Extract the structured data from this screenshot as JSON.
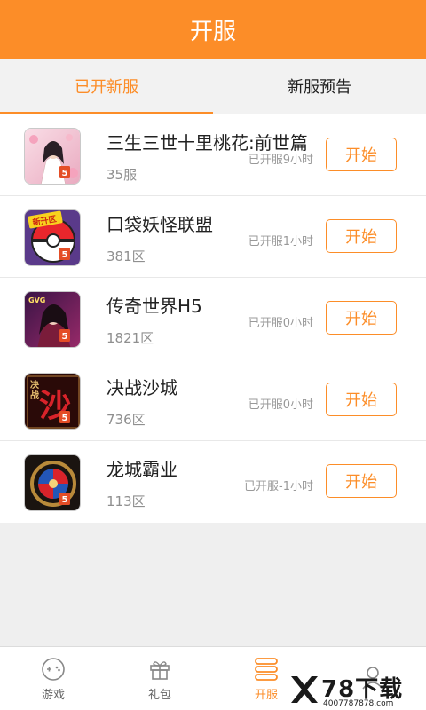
{
  "header": {
    "title": "开服"
  },
  "tabs": [
    {
      "label": "已开新服",
      "active": true
    },
    {
      "label": "新服预告",
      "active": false
    }
  ],
  "games": [
    {
      "title": "三生三世十里桃花:前世篇",
      "server": "35服",
      "status": "已开服9小时",
      "button": "开始",
      "icon": "peach-blossom-game-icon"
    },
    {
      "title": "口袋妖怪联盟",
      "server": "381区",
      "status": "已开服1小时",
      "button": "开始",
      "icon": "pokeball-game-icon"
    },
    {
      "title": "传奇世界H5",
      "server": "1821区",
      "status": "已开服0小时",
      "button": "开始",
      "icon": "legend-world-game-icon"
    },
    {
      "title": "决战沙城",
      "server": "736区",
      "status": "已开服0小时",
      "button": "开始",
      "icon": "sand-city-game-icon"
    },
    {
      "title": "龙城霸业",
      "server": "113区",
      "status": "已开服-1小时",
      "button": "开始",
      "icon": "dragon-city-game-icon"
    }
  ],
  "icon_badge": "5",
  "icon_texts": {
    "pokeball": "新开区",
    "legend": "GVG",
    "sand_a": "决",
    "sand_b": "战",
    "sand_c": "沙"
  },
  "bottom_nav": [
    {
      "label": "游戏",
      "icon": "gamepad-icon",
      "active": false
    },
    {
      "label": "礼包",
      "icon": "gift-icon",
      "active": false
    },
    {
      "label": "开服",
      "icon": "server-list-icon",
      "active": true
    },
    {
      "label": "",
      "icon": "user-icon",
      "active": false
    }
  ],
  "watermark": {
    "brand": "78下载",
    "url": "4007787878.com"
  },
  "colors": {
    "accent": "#fc8d28",
    "text": "#222222",
    "muted": "#8f8f8f"
  }
}
